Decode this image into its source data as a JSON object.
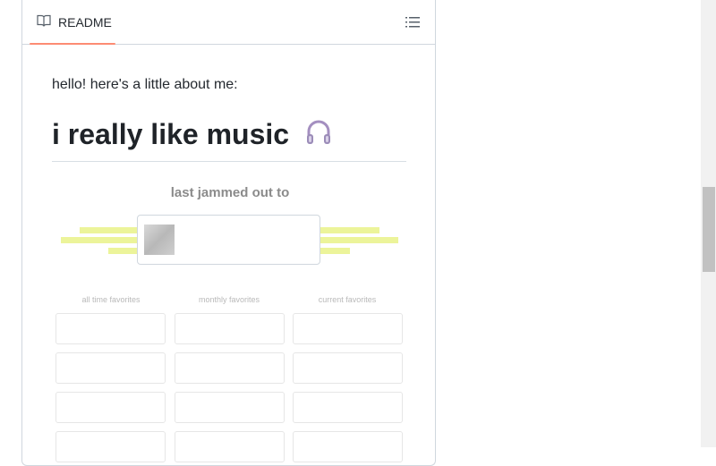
{
  "readme": {
    "tab_label": "README",
    "intro": "hello! here's a little about me:",
    "heading": "i really like music",
    "heading_emoji_icon": "headphones-icon",
    "last_jammed_label": "last jammed out to"
  },
  "favorites": {
    "labels": [
      "all time favorites",
      "monthly favorites",
      "current favorites"
    ],
    "rows_visible": 4
  },
  "colors": {
    "tab_underline": "#fd8c73",
    "bars": "#ecf49a",
    "border": "#d0d7de"
  }
}
